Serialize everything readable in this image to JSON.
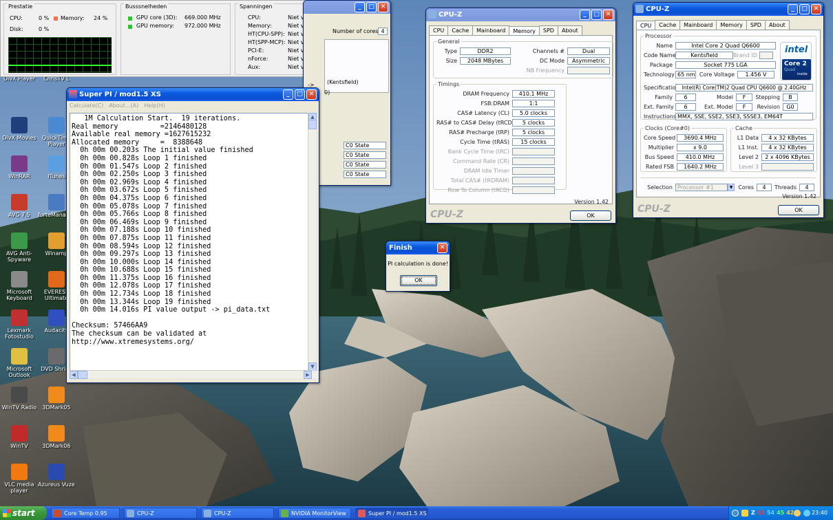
{
  "core_temp": {
    "prestatie_title": "Prestatie",
    "cpu_label": "CPU:",
    "cpu_value": "0 %",
    "memory_label": "Memory:",
    "memory_value": "24 %",
    "disk_label": "Disk:",
    "disk_value": "0 %",
    "bus_title": "Busssnelheden",
    "gpu_core_label": "GPU core (3D):",
    "gpu_core_value": "669.000 MHz",
    "gpu_mem_label": "GPU memory:",
    "gpu_mem_value": "972.000 MHz",
    "spanningen_title": "Spanningen",
    "voltages": [
      {
        "label": "CPU:",
        "value": "Niet vermeld"
      },
      {
        "label": "Memory:",
        "value": "Niet vermeld"
      },
      {
        "label": "HT(CPU-SPP):",
        "value": "Niet vermeld"
      },
      {
        "label": "HT(SPP-MCP):",
        "value": "Niet vermeld"
      },
      {
        "label": "PCI-E:",
        "value": "Niet vermeld"
      },
      {
        "label": "nForce:",
        "value": "Niet vermeld"
      },
      {
        "label": "Aux:",
        "value": "Niet vermeld"
      }
    ]
  },
  "bg_window": {
    "num_cores_label": "Number of cores",
    "num_cores_value": "4",
    "kentsfield": "(Kentsfield)",
    "arrow": "->",
    "zero": "0)",
    "states": [
      "C0 State",
      "C0 State",
      "C0 State",
      "C0 State"
    ]
  },
  "desktop_icons": [
    {
      "label": "DivX Player",
      "color": "#2a4f8a"
    },
    {
      "label": "ChrisTV L",
      "color": "#3a6ab0"
    },
    {
      "label": "DivX Movies",
      "color": "#1e3f7c"
    },
    {
      "label": "QuickTime Player",
      "color": "#4a8ad0"
    },
    {
      "label": "WinRAR",
      "color": "#7a3a8a"
    },
    {
      "label": "iTunes",
      "color": "#5aa0e0"
    },
    {
      "label": "AVG 7.5",
      "color": "#c83a2a"
    },
    {
      "label": "forteManager",
      "color": "#4a7ac0"
    },
    {
      "label": "AVG Anti-Spyware",
      "color": "#3a9a4a"
    },
    {
      "label": "Winamp",
      "color": "#e0a030"
    },
    {
      "label": "Microsoft Keyboard",
      "color": "#8a8a8a"
    },
    {
      "label": "EVEREST Ultimate",
      "color": "#e06a1a"
    },
    {
      "label": "Lexmark Fotostudio",
      "color": "#c03030"
    },
    {
      "label": "Audacity",
      "color": "#3050c0"
    },
    {
      "label": "Microsoft Outlook",
      "color": "#e0c040"
    },
    {
      "label": "DVD Shrink",
      "color": "#6a6a6a"
    },
    {
      "label": "WinTV Radio",
      "color": "#4a4a4a"
    },
    {
      "label": "3DMark05",
      "color": "#f08a1a"
    },
    {
      "label": "WinTV",
      "color": "#c02a2a"
    },
    {
      "label": "3DMark06",
      "color": "#f08a1a"
    },
    {
      "label": "VLC media player",
      "color": "#f07a10"
    },
    {
      "label": "Azureus Vuze",
      "color": "#2a4ab0"
    }
  ],
  "superpi": {
    "title": "Super PI / mod1.5 XS",
    "menu": [
      "Calculate(C)",
      "About...(A)",
      "Help(H)"
    ],
    "output": [
      "   1M Calculation Start.  19 iterations.",
      "Real memory          =2146480128",
      "Available real memory =1627615232",
      "Allocated memory     =  8388648",
      "  0h 00m 00.203s The initial value finished",
      "  0h 00m 00.828s Loop 1 finished",
      "  0h 00m 01.547s Loop 2 finished",
      "  0h 00m 02.250s Loop 3 finished",
      "  0h 00m 02.969s Loop 4 finished",
      "  0h 00m 03.672s Loop 5 finished",
      "  0h 00m 04.375s Loop 6 finished",
      "  0h 00m 05.078s Loop 7 finished",
      "  0h 00m 05.766s Loop 8 finished",
      "  0h 00m 06.469s Loop 9 finished",
      "  0h 00m 07.188s Loop 10 finished",
      "  0h 00m 07.875s Loop 11 finished",
      "  0h 00m 08.594s Loop 12 finished",
      "  0h 00m 09.297s Loop 13 finished",
      "  0h 00m 10.000s Loop 14 finished",
      "  0h 00m 10.688s Loop 15 finished",
      "  0h 00m 11.375s Loop 16 finished",
      "  0h 00m 12.078s Loop 17 finished",
      "  0h 00m 12.734s Loop 18 finished",
      "  0h 00m 13.344s Loop 19 finished",
      "  0h 00m 14.016s PI value output -> pi_data.txt",
      "",
      "Checksum: 57466AA9",
      "The checksum can be validated at",
      "http://www.xtremesystems.org/"
    ]
  },
  "finish_dialog": {
    "title": "Finish",
    "message": "PI calculation is done!",
    "ok": "OK"
  },
  "cpuz_memory": {
    "title": "CPU-Z",
    "tabs": [
      "CPU",
      "Cache",
      "Mainboard",
      "Memory",
      "SPD",
      "About"
    ],
    "active_tab": "Memory",
    "general_legend": "General",
    "type_label": "Type",
    "type_value": "DDR2",
    "size_label": "Size",
    "size_value": "2048 MBytes",
    "channels_label": "Channels #",
    "channels_value": "Dual",
    "dcmode_label": "DC Mode",
    "dcmode_value": "Asymmetric",
    "nbfreq_label": "NB Frequency",
    "timings_legend": "Timings",
    "timings": [
      {
        "label": "DRAM Frequency",
        "value": "410.1 MHz",
        "enabled": true
      },
      {
        "label": "FSB:DRAM",
        "value": "1:1",
        "enabled": true
      },
      {
        "label": "CAS# Latency (CL)",
        "value": "5.0 clocks",
        "enabled": true
      },
      {
        "label": "RAS# to CAS# Delay (tRCD)",
        "value": "5 clocks",
        "enabled": true
      },
      {
        "label": "RAS# Precharge (tRP)",
        "value": "5 clocks",
        "enabled": true
      },
      {
        "label": "Cycle Time (tRAS)",
        "value": "15 clocks",
        "enabled": true
      },
      {
        "label": "Bank Cycle Time (tRC)",
        "value": "",
        "enabled": false
      },
      {
        "label": "Command Rate (CR)",
        "value": "",
        "enabled": false
      },
      {
        "label": "DRAM Idle Timer",
        "value": "",
        "enabled": false
      },
      {
        "label": "Total CAS# (tRDRAM)",
        "value": "",
        "enabled": false
      },
      {
        "label": "Row To Column (tRCD)",
        "value": "",
        "enabled": false
      }
    ],
    "version": "Version 1.42",
    "logo": "CPU-Z",
    "ok": "OK"
  },
  "cpuz_cpu": {
    "title": "CPU-Z",
    "tabs": [
      "CPU",
      "Cache",
      "Mainboard",
      "Memory",
      "SPD",
      "About"
    ],
    "active_tab": "CPU",
    "processor_legend": "Processor",
    "name_label": "Name",
    "name_value": "Intel Core 2 Quad Q6600",
    "codename_label": "Code Name",
    "codename_value": "Kentsfield",
    "brandid_label": "Brand ID",
    "package_label": "Package",
    "package_value": "Socket 775 LGA",
    "technology_label": "Technology",
    "technology_value": "65 nm",
    "corevoltage_label": "Core Voltage",
    "corevoltage_value": "1.456 V",
    "spec_label": "Specification",
    "spec_value": "Intel(R) Core(TM)2 Quad CPU   Q6600  @ 2.40GHz",
    "family_label": "Family",
    "family_value": "6",
    "model_label": "Model",
    "model_value": "F",
    "stepping_label": "Stepping",
    "stepping_value": "B",
    "extfamily_label": "Ext. Family",
    "extfamily_value": "6",
    "extmodel_label": "Ext. Model",
    "extmodel_value": "F",
    "revision_label": "Revision",
    "revision_value": "G0",
    "instructions_label": "Instructions",
    "instructions_value": "MMX, SSE, SSE2, SSE3, SSSE3, EM64T",
    "clocks_legend": "Clocks (Core#0)",
    "corespeed_label": "Core Speed",
    "corespeed_value": "3690.4 MHz",
    "multiplier_label": "Multiplier",
    "multiplier_value": "x 9.0",
    "busspeed_label": "Bus Speed",
    "busspeed_value": "410.0 MHz",
    "ratedfsb_label": "Rated FSB",
    "ratedfsb_value": "1640.2 MHz",
    "cache_legend": "Cache",
    "l1data_label": "L1 Data",
    "l1data_value": "4 x 32 KBytes",
    "l1inst_label": "L1 Inst.",
    "l1inst_value": "4 x 32 KBytes",
    "level2_label": "Level 2",
    "level2_value": "2 x 4096 KBytes",
    "level3_label": "Level 3",
    "selection_label": "Selection",
    "selection_value": "Processor #1",
    "cores_label": "Cores",
    "cores_value": "4",
    "threads_label": "Threads",
    "threads_value": "4",
    "intel_logo": "intel",
    "core2_logo": "Core 2",
    "quad_logo": "Quad",
    "inside_logo": "inside",
    "version": "Version 1.42",
    "logo": "CPU-Z",
    "ok": "OK"
  },
  "taskbar": {
    "start": "start",
    "tasks": [
      {
        "label": "Core Temp 0.95",
        "color": "#d04a2a",
        "active": false
      },
      {
        "label": "CPU-Z",
        "color": "#8ab0e0",
        "active": false
      },
      {
        "label": "CPU-Z",
        "color": "#8ab0e0",
        "active": false
      },
      {
        "label": "NVIDIA MonitorView",
        "color": "#6ab04a",
        "active": false
      },
      {
        "label": "Super PI / mod1.5 XS",
        "color": "#e05a5a",
        "active": true
      }
    ],
    "tray_temps": [
      "Z",
      "52",
      "54",
      "45",
      "42"
    ],
    "clock": "23:40"
  }
}
